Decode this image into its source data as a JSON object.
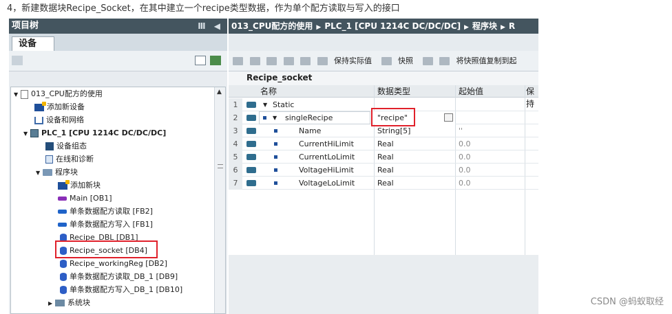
{
  "caption": "4，新建数据块Recipe_Socket，在其中建立一个recipe类型数据，作为单个配方读取与写入的接口",
  "watermark": "CSDN @蚂蚁取经",
  "project_tree": {
    "title": "项目树",
    "collapse_glyph": "Ⅲ ◀",
    "tab": "设备",
    "items": [
      {
        "label": "013_CPU配方的使用",
        "arrow": "▼",
        "icon": "project-icon"
      },
      {
        "label": "添加新设备",
        "arrow": "",
        "icon": "add-device-icon"
      },
      {
        "label": "设备和网络",
        "arrow": "",
        "icon": "network-icon"
      },
      {
        "label": "PLC_1 [CPU 1214C DC/DC/DC]",
        "arrow": "▼",
        "icon": "plc-icon"
      },
      {
        "label": "设备组态",
        "arrow": "",
        "icon": "device-config-icon"
      },
      {
        "label": "在线和诊断",
        "arrow": "",
        "icon": "diagnostics-icon"
      },
      {
        "label": "程序块",
        "arrow": "▼",
        "icon": "folder-icon"
      },
      {
        "label": "添加新块",
        "arrow": "",
        "icon": "add-block-icon"
      },
      {
        "label": "Main [OB1]",
        "arrow": "",
        "icon": "ob-icon"
      },
      {
        "label": "单条数据配方读取 [FB2]",
        "arrow": "",
        "icon": "fb-icon"
      },
      {
        "label": "单条数据配方写入 [FB1]",
        "arrow": "",
        "icon": "fb-icon"
      },
      {
        "label": "Recipe_DBL [DB1]",
        "arrow": "",
        "icon": "db-icon"
      },
      {
        "label": "Recipe_socket [DB4]",
        "arrow": "",
        "icon": "db-icon"
      },
      {
        "label": "Recipe_workingReg [DB2]",
        "arrow": "",
        "icon": "db-icon"
      },
      {
        "label": "单条数据配方读取_DB_1 [DB9]",
        "arrow": "",
        "icon": "db-icon"
      },
      {
        "label": "单条数据配方写入_DB_1 [DB10]",
        "arrow": "",
        "icon": "db-icon"
      },
      {
        "label": "系统块",
        "arrow": "▶",
        "icon": "system-folder-icon"
      }
    ]
  },
  "editor": {
    "breadcrumb": [
      "013_CPU配方的使用",
      "PLC_1 [CPU 1214C DC/DC/DC]",
      "程序块",
      "R"
    ],
    "toolbar": {
      "keep_actual": "保持实际值",
      "snapshot": "快照",
      "copy_snapshot": "将快照值复制到起"
    },
    "block_name": "Recipe_socket",
    "columns": [
      "名称",
      "数据类型",
      "起始值",
      "保持"
    ],
    "rows": [
      {
        "num": "1",
        "name": "Static",
        "type": "",
        "start": ""
      },
      {
        "num": "2",
        "name": "singleRecipe",
        "type": "\"recipe\"",
        "start": ""
      },
      {
        "num": "3",
        "name": "Name",
        "type": "String[5]",
        "start": "''"
      },
      {
        "num": "4",
        "name": "CurrentHiLimit",
        "type": "Real",
        "start": "0.0"
      },
      {
        "num": "5",
        "name": "CurrentLoLimit",
        "type": "Real",
        "start": "0.0"
      },
      {
        "num": "6",
        "name": "VoltageHiLimit",
        "type": "Real",
        "start": "0.0"
      },
      {
        "num": "7",
        "name": "VoltageLoLimit",
        "type": "Real",
        "start": "0.0"
      }
    ]
  },
  "colors": {
    "highlight": "#e0202a",
    "title_bar": "#44555f"
  }
}
